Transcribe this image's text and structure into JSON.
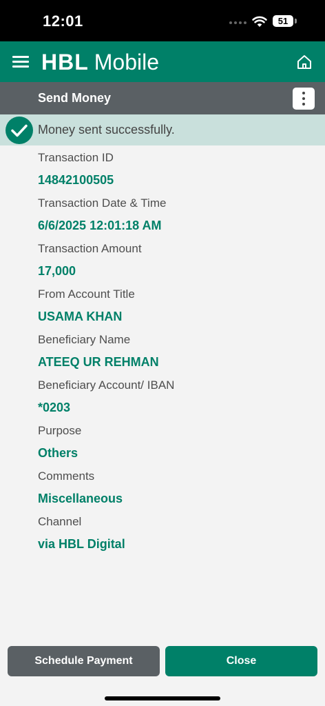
{
  "status_bar": {
    "time": "12:01",
    "battery": "51",
    "wifi_icon": "wifi-icon",
    "battery_icon": "battery-icon"
  },
  "header": {
    "brand_primary": "HBL",
    "brand_secondary": "Mobile",
    "menu_icon": "hamburger-menu-icon",
    "home_icon": "home-icon"
  },
  "title_bar": {
    "title": "Send Money",
    "more_icon": "more-vertical-icon"
  },
  "banner": {
    "message": "Money sent successfully.",
    "icon": "checkmark-circle-icon"
  },
  "details": [
    {
      "label": "Transaction ID",
      "value": "14842100505"
    },
    {
      "label": "Transaction Date & Time",
      "value": "6/6/2025 12:01:18 AM"
    },
    {
      "label": "Transaction Amount",
      "value": "17,000"
    },
    {
      "label": "From Account Title",
      "value": "USAMA KHAN"
    },
    {
      "label": "Beneficiary Name",
      "value": "ATEEQ UR REHMAN"
    },
    {
      "label": "Beneficiary Account/ IBAN",
      "value": "*0203"
    },
    {
      "label": "Purpose",
      "value": "Others"
    },
    {
      "label": "Comments",
      "value": "Miscellaneous"
    },
    {
      "label": "Channel",
      "value": "via HBL Digital"
    }
  ],
  "actions": {
    "schedule_label": "Schedule Payment",
    "close_label": "Close"
  },
  "colors": {
    "brand_green": "#008068",
    "toolbar_gray": "#5a6064",
    "banner_bg": "#c9e0dc",
    "page_bg": "#f3f3f3"
  }
}
